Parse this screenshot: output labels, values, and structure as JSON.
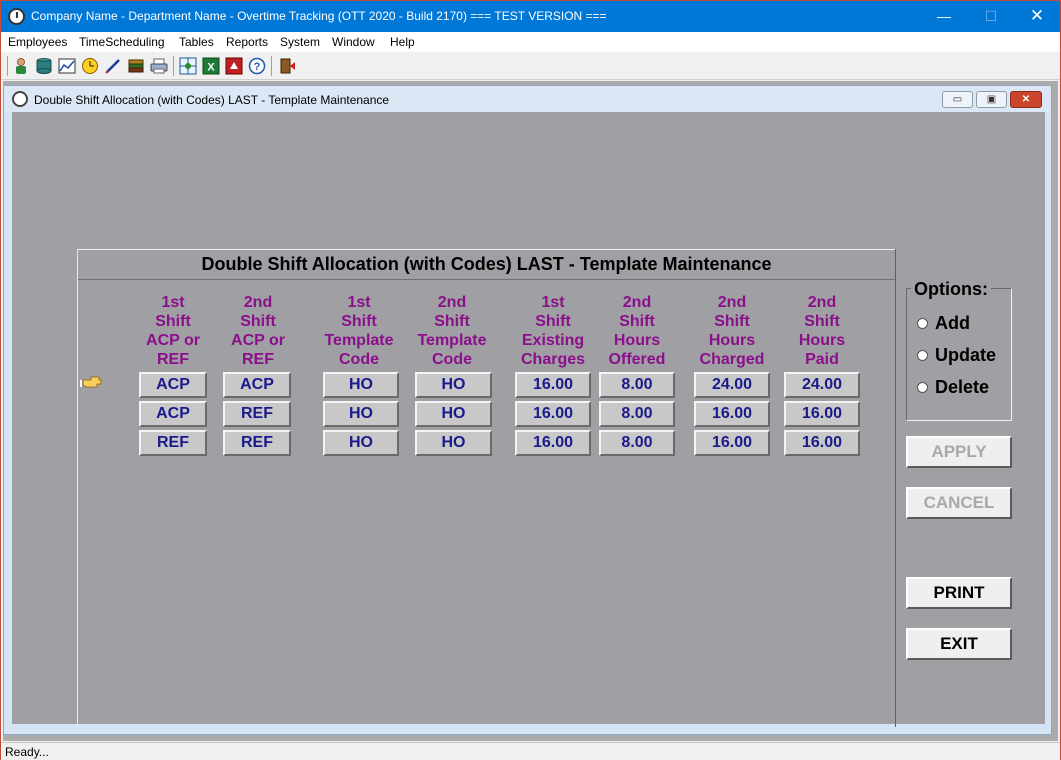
{
  "window": {
    "title": "Company Name - Department Name - Overtime Tracking (OTT 2020 - Build 2170) === TEST VERSION ===",
    "min_glyph": "—",
    "max_glyph": "☐",
    "close_glyph": "✕"
  },
  "menu": {
    "items": [
      "Employees",
      "TimeScheduling",
      "Tables",
      "Reports",
      "System",
      "Window",
      "Help"
    ]
  },
  "toolbar": {
    "icons": [
      "employee-icon",
      "database-icon",
      "chart-icon",
      "clock-icon",
      "pen-icon",
      "books-icon",
      "printer-icon",
      "grid-icon",
      "excel-icon",
      "export-icon",
      "help-icon",
      "exit-door-icon"
    ]
  },
  "child": {
    "title": "Double Shift Allocation (with Codes) LAST - Template Maintenance",
    "min_glyph": "▭",
    "max_glyph": "▣",
    "close_glyph": "✕"
  },
  "form": {
    "heading": "Double Shift Allocation (with Codes) LAST - Template Maintenance",
    "columns": [
      [
        "1st",
        "Shift",
        "ACP or",
        "REF"
      ],
      [
        "2nd",
        "Shift",
        "ACP or",
        "REF"
      ],
      [
        "1st",
        "Shift",
        "Template",
        "Code"
      ],
      [
        "2nd",
        "Shift",
        "Template",
        "Code"
      ],
      [
        "1st",
        "Shift",
        "Existing",
        "Charges"
      ],
      [
        "2nd",
        "Shift",
        "Hours",
        "Offered"
      ],
      [
        "2nd",
        "Shift",
        "Hours",
        "Charged"
      ],
      [
        "2nd",
        "Shift",
        "Hours",
        "Paid"
      ]
    ],
    "rows": [
      [
        "ACP",
        "ACP",
        "HO",
        "HO",
        "16.00",
        "8.00",
        "24.00",
        "24.00"
      ],
      [
        "ACP",
        "REF",
        "HO",
        "HO",
        "16.00",
        "8.00",
        "16.00",
        "16.00"
      ],
      [
        "REF",
        "REF",
        "HO",
        "HO",
        "16.00",
        "8.00",
        "16.00",
        "16.00"
      ]
    ]
  },
  "options": {
    "legend": "Options:",
    "items": [
      "Add",
      "Update",
      "Delete"
    ]
  },
  "buttons": {
    "apply": "APPLY",
    "cancel": "CANCEL",
    "print": "PRINT",
    "exit": "EXIT"
  },
  "status": {
    "text": "Ready..."
  },
  "colors": {
    "header_text": "#8b0f8b",
    "cell_text": "#1a1a8c",
    "title_bar": "#0078d7"
  }
}
